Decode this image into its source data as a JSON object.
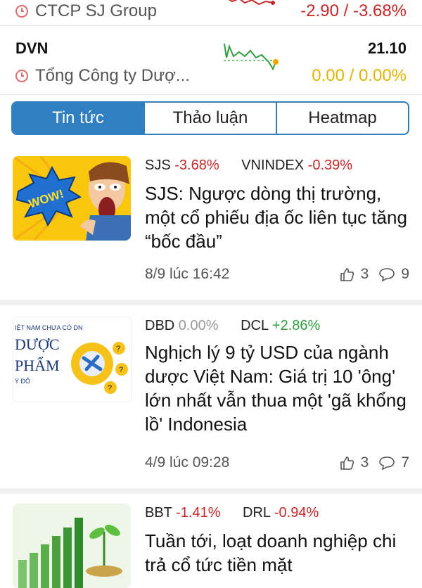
{
  "stocks": [
    {
      "ticker": "",
      "company": "CTCP SJ Group",
      "price": "",
      "change": "-2.90 / -3.68%"
    },
    {
      "ticker": "DVN",
      "company": "Tổng Công ty Dượ...",
      "price": "21.10",
      "change": "0.00 / 0.00%"
    }
  ],
  "tabs": [
    {
      "label": "Tin tức",
      "active": true
    },
    {
      "label": "Thảo luận",
      "active": false
    },
    {
      "label": "Heatmap",
      "active": false
    }
  ],
  "news": [
    {
      "tags": [
        {
          "code": "SJS",
          "change": "-3.68%"
        },
        {
          "code": "VNINDEX",
          "change": "-0.39%"
        }
      ],
      "title": "SJS: Ngược dòng thị trường, một cổ phiếu địa ốc liên tục tăng “bốc đầu”",
      "date": "8/9 lúc 16:42",
      "likes": "3",
      "comments": "9",
      "thumb_text": "WOW!"
    },
    {
      "tags": [
        {
          "code": "DBD",
          "change": "0.00%"
        },
        {
          "code": "DCL",
          "change": "+2.86%"
        }
      ],
      "title": "Nghịch lý 9 tỷ USD của ngành dược Việt Nam: Giá trị 10 'ông' lớn nhất vẫn thua một 'gã khổng lồ' Indonesia",
      "date": "4/9 lúc 09:28",
      "likes": "3",
      "comments": "7",
      "thumb_text": [
        "IỆT NAM CHƯA CÓ DN",
        "DƯỢC",
        "PHẨM",
        "Ý ĐÔ"
      ]
    },
    {
      "tags": [
        {
          "code": "BBT",
          "change": "-1.41%"
        },
        {
          "code": "DRL",
          "change": "-0.94%"
        }
      ],
      "title": "Tuần tới, loạt doanh nghiệp chi trả cổ tức tiền mặt"
    }
  ],
  "colors": {
    "accent": "#2f7fc1",
    "down": "#c62828",
    "up": "#2e9e3e",
    "flat": "#e2b400"
  },
  "icons": [
    "clock-icon",
    "thumbs-up-icon",
    "comment-icon"
  ]
}
